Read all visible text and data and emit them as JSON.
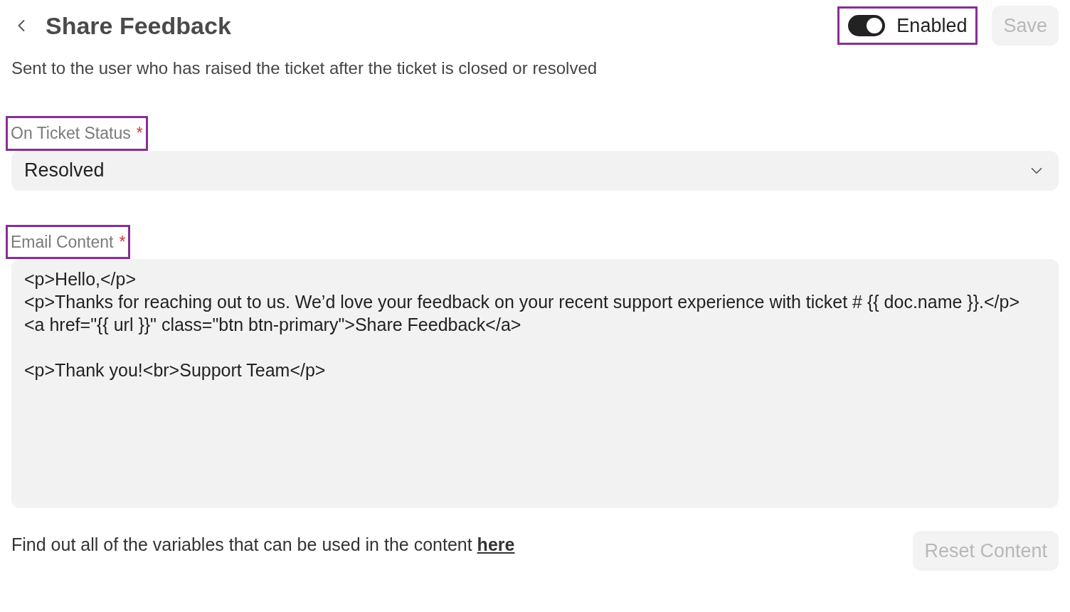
{
  "header": {
    "title": "Share Feedback"
  },
  "toggle": {
    "label": "Enabled",
    "on": true,
    "highlighted": true
  },
  "save_button": {
    "label": "Save",
    "disabled": true
  },
  "description": "Sent to the user who has raised the ticket after the ticket is closed or resolved",
  "status_field": {
    "label": "On Ticket Status",
    "required_mark": "*",
    "highlighted": true,
    "value": "Resolved"
  },
  "content_field": {
    "label": "Email Content",
    "required_mark": "*",
    "highlighted": true,
    "blocks": [
      [
        "<p>Hello,</p>",
        "<p>Thanks for reaching out to us. We’d love your feedback on your recent support experience with ticket # {{ doc.name }}.</p>",
        "<a href=\"{{ url }}\" class=\"btn btn-primary\">Share Feedback</a>"
      ],
      [
        "<p>Thank you!<br>Support Team</p>"
      ]
    ]
  },
  "footer": {
    "hint": "Find out all of the variables that can be used in the content",
    "link": "here",
    "reset_button": {
      "label": "Reset Content",
      "disabled": true
    }
  }
}
